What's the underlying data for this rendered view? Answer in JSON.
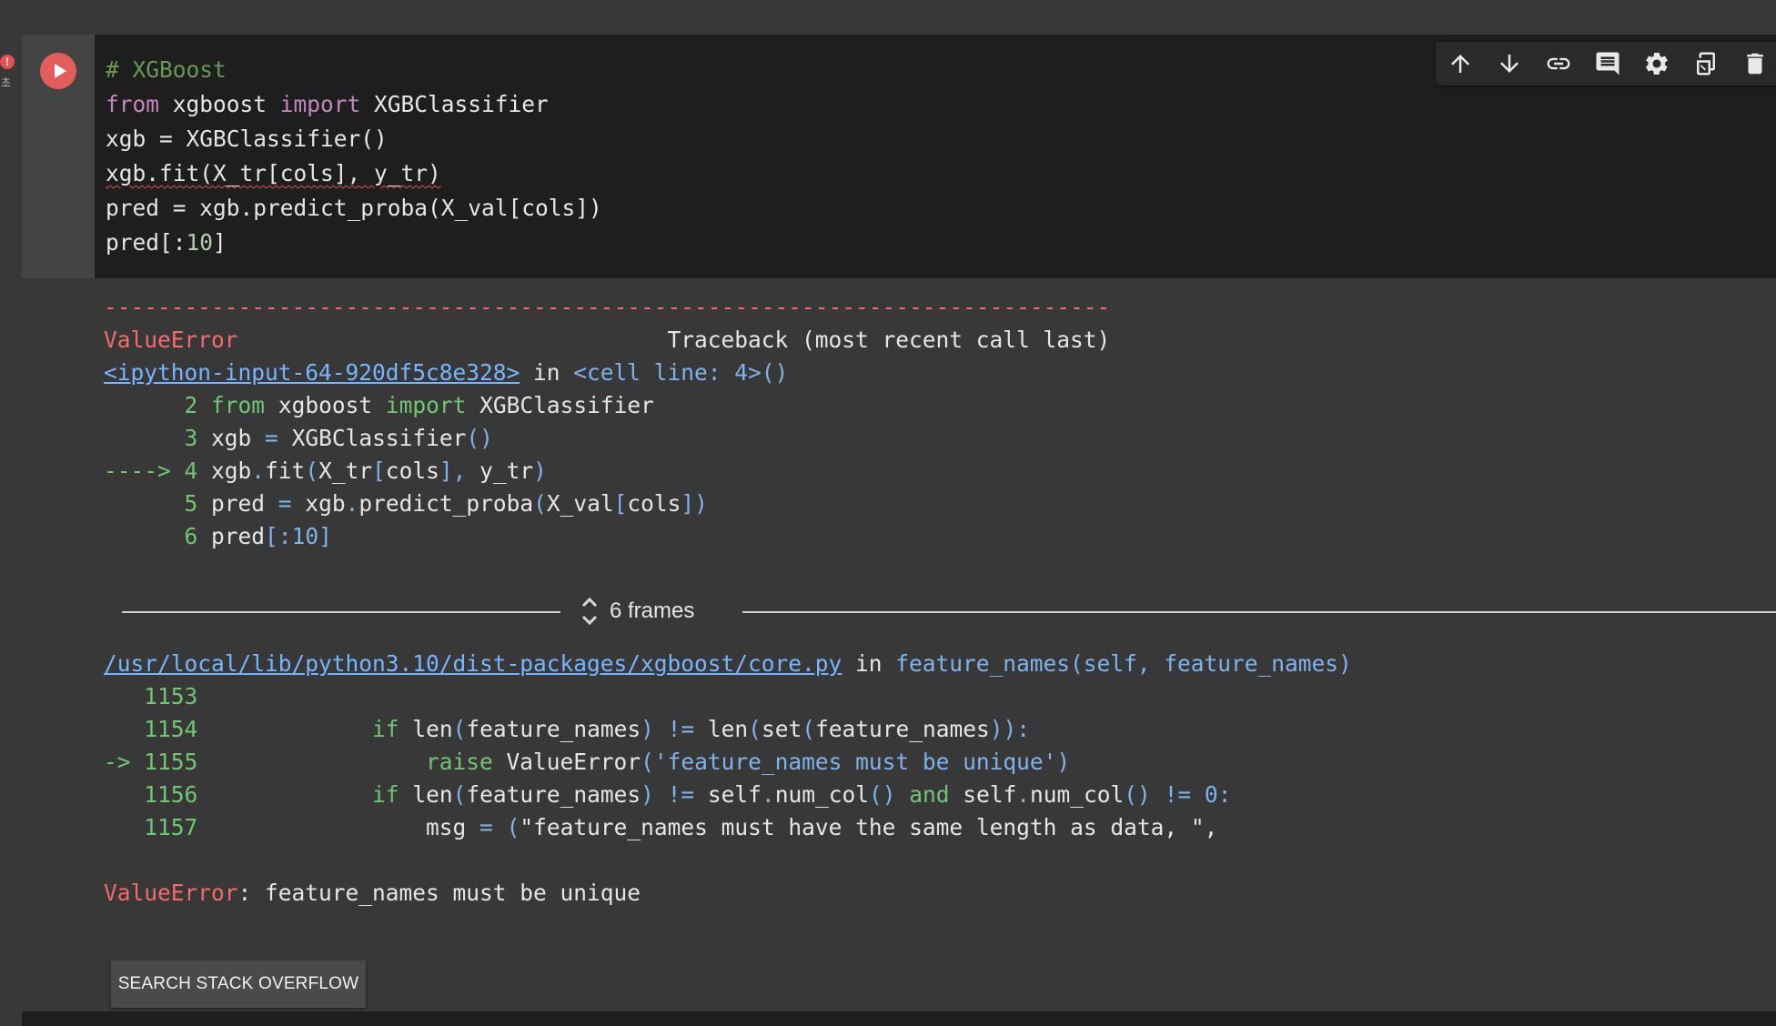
{
  "left_status": {
    "error_marker": "!",
    "time_label": "초"
  },
  "toolbar": {
    "icons": [
      "arrow-up-icon",
      "arrow-down-icon",
      "link-icon",
      "comment-icon",
      "gear-icon",
      "mirror-cell-icon",
      "trash-icon"
    ]
  },
  "cell": {
    "code": {
      "line1": "# XGBoost",
      "line2_kw1": "from",
      "line2_mid": " xgboost ",
      "line2_kw2": "import",
      "line2_rest": " XGBClassifier",
      "line3": "xgb = XGBClassifier()",
      "line4": "xgb.fit(X_tr[cols], y_tr)",
      "line5": "pred = xgb.predict_proba(X_val[cols])",
      "line6_a": "pred[:",
      "line6_num": "10",
      "line6_b": "]"
    }
  },
  "output": {
    "dashes": "---------------------------------------------------------------------------",
    "error_name": "ValueError",
    "traceback_label": "Traceback (most recent call last)",
    "input_link": "<ipython-input-64-920df5c8e328>",
    "in_word": " in ",
    "cell_ref": "<cell line: 4>()",
    "frames_label": "6 frames",
    "core_link": "/usr/local/lib/python3.10/dist-packages/xgboost/core.py",
    "core_in": " in ",
    "core_func": "feature_names(self, feature_names)",
    "final_error_name": "ValueError",
    "final_error_msg": ": feature_names must be unique",
    "so_button": "SEARCH STACK OVERFLOW"
  }
}
